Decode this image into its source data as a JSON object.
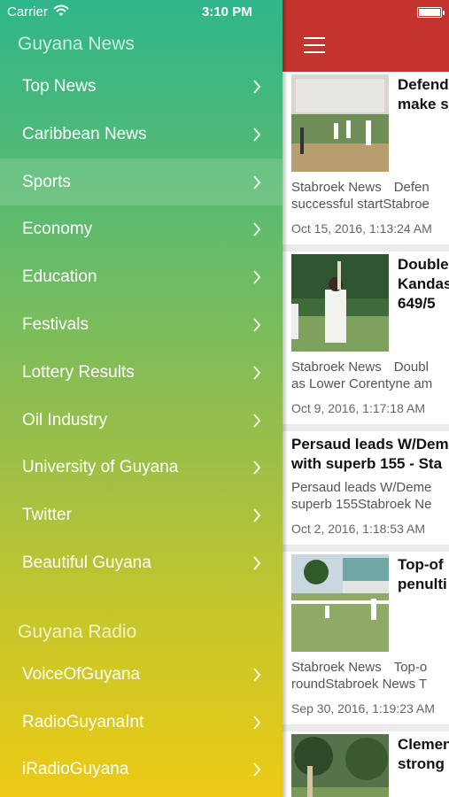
{
  "status_bar": {
    "carrier": "Carrier",
    "time": "3:10 PM"
  },
  "menu": {
    "news_section_title": "Guyana News",
    "news_items": [
      {
        "label": "Top News"
      },
      {
        "label": "Caribbean News"
      },
      {
        "label": "Sports",
        "selected": true
      },
      {
        "label": "Economy"
      },
      {
        "label": "Education"
      },
      {
        "label": "Festivals"
      },
      {
        "label": "Lottery Results"
      },
      {
        "label": "Oil Industry"
      },
      {
        "label": "University of Guyana"
      },
      {
        "label": "Twitter"
      },
      {
        "label": "Beautiful Guyana"
      }
    ],
    "radio_section_title": "Guyana Radio",
    "radio_items": [
      {
        "label": "VoiceOfGuyana"
      },
      {
        "label": "RadioGuyanaInt"
      },
      {
        "label": "iRadioGuyana"
      }
    ]
  },
  "colors": {
    "nav_bar": "#c3342c",
    "menu_top": "#2fb68a",
    "menu_bottom": "#ecca14"
  },
  "feed": [
    {
      "thumb": "cricket-field-wide",
      "title_lines": [
        "Defend",
        "make s"
      ],
      "source": "Stabroek News",
      "desc_line1_rest": "Defen",
      "desc_line2": "successful startStabroe",
      "date": "Oct 15, 2016, 1:13:24 AM"
    },
    {
      "thumb": "batsman-closeup",
      "title_lines": [
        "Double",
        "Kandas",
        "649/5"
      ],
      "source": "Stabroek News",
      "desc_line1_rest": "Doubl",
      "desc_line2": "as Lower Corentyne am",
      "date": "Oct 9, 2016, 1:17:18 AM"
    },
    {
      "text_only": true,
      "title_lines": [
        "Persaud leads W/Dem",
        "with superb 155 - Sta"
      ],
      "desc_line1": "Persaud leads W/Deme",
      "desc_line2": "superb 155Stabroek Ne",
      "date": "Oct 2, 2016, 1:18:53 AM"
    },
    {
      "thumb": "cricket-ground-buildings",
      "title_lines": [
        "Top-of",
        "penulti"
      ],
      "source": "Stabroek News",
      "desc_line1_rest": "Top-o",
      "desc_line2": "roundStabroek News  T",
      "date": "Sep 30, 2016, 1:19:23 AM"
    },
    {
      "thumb": "cricket-trees",
      "title_lines": [
        "Clemen",
        "strong"
      ],
      "partial": true
    }
  ]
}
